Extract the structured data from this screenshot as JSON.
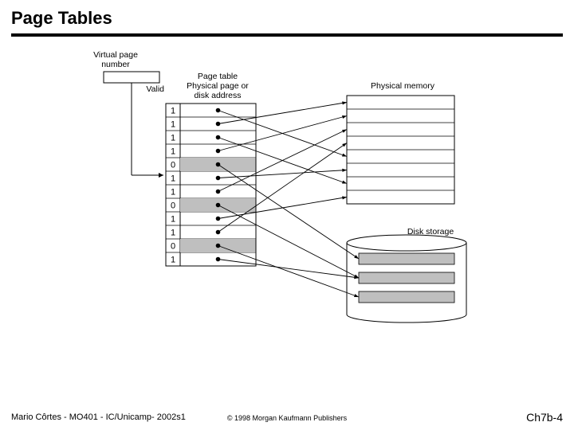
{
  "title": "Page Tables",
  "labels": {
    "vpn": "Virtual page\nnumber",
    "valid": "Valid",
    "ptHeader": "Page table\nPhysical page or\ndisk address",
    "physmem": "Physical memory",
    "disk": "Disk storage"
  },
  "valid_bits": [
    "1",
    "1",
    "1",
    "1",
    "0",
    "1",
    "1",
    "0",
    "1",
    "1",
    "0",
    "1"
  ],
  "mappings": [
    {
      "row": 0,
      "target": "mem",
      "slot": 4
    },
    {
      "row": 1,
      "target": "mem",
      "slot": 0
    },
    {
      "row": 2,
      "target": "mem",
      "slot": 6
    },
    {
      "row": 3,
      "target": "mem",
      "slot": 1
    },
    {
      "row": 4,
      "target": "disk",
      "slot": 0
    },
    {
      "row": 5,
      "target": "mem",
      "slot": 5
    },
    {
      "row": 6,
      "target": "mem",
      "slot": 2
    },
    {
      "row": 7,
      "target": "disk",
      "slot": 1
    },
    {
      "row": 8,
      "target": "mem",
      "slot": 7
    },
    {
      "row": 9,
      "target": "mem",
      "slot": 3
    },
    {
      "row": 10,
      "target": "disk",
      "slot": 2
    },
    {
      "row": 11,
      "target": "disk",
      "slot": 1
    }
  ],
  "memory_slots": 8,
  "disk_slots": 3,
  "footer": {
    "left": "Mario Côrtes - MO401 - IC/Unicamp- 2002s1",
    "center": "© 1998 Morgan Kaufmann Publishers",
    "right": "Ch7b-4"
  }
}
